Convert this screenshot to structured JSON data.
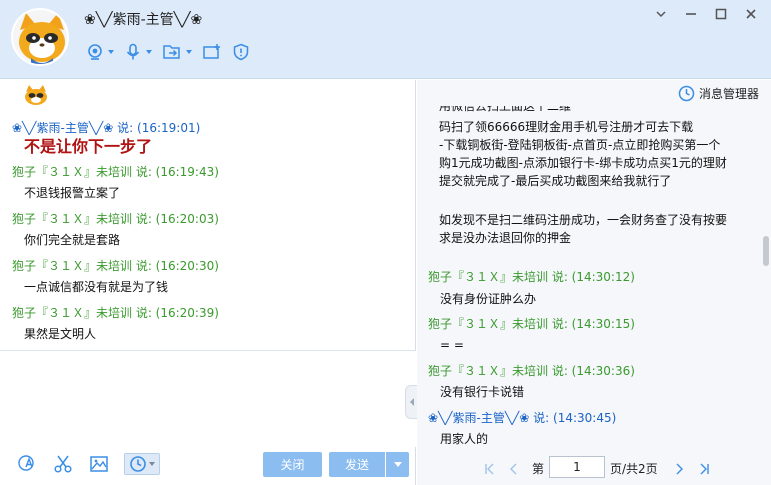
{
  "window": {
    "title": "❀╲╱紫雨-主管╲╱❀"
  },
  "toolbar": {
    "icons": [
      "webcam-icon",
      "microphone-icon",
      "file-transfer-icon",
      "screen-share-icon",
      "shield-icon"
    ]
  },
  "left_chat": {
    "messages": [
      {
        "sender": "❀╲╱紫雨-主管╲╱❀ 说: (16:19:01)",
        "text": "不是让你下一步了",
        "highlight": true
      },
      {
        "sender": "狍子『３１Ｘ』未培训 说: (16:19:43)",
        "text": "不退钱报警立案了"
      },
      {
        "sender": "狍子『３１Ｘ』未培训 说: (16:20:03)",
        "text": "你们完全就是套路"
      },
      {
        "sender": "狍子『３１Ｘ』未培训 说: (16:20:30)",
        "text": "一点诚信都没有就是为了钱"
      },
      {
        "sender": "狍子『３１Ｘ』未培训 说: (16:20:39)",
        "text": "果然是文明人"
      }
    ]
  },
  "bottom_bar": {
    "close_label": "关闭",
    "send_label": "发送"
  },
  "right_panel": {
    "message_manager_label": "消息管理器",
    "cut_line": "用微信去扫上面这个二维",
    "paragraph1": [
      "码扫了领66666理财金用手机号注册才可去下载",
      "-下载铜板街-登陆铜板街-点首页-点立即抢购买第一个",
      "购1元成功截图-点添加银行卡-绑卡成功点买1元的理财",
      "提交就完成了-最后买成功截图来给我就行了"
    ],
    "paragraph2": [
      "如发现不是扫二维码注册成功，一会财务查了没有按要",
      "求是没办法退回你的押金"
    ],
    "messages": [
      {
        "sender": "狍子『３１Ｘ』未培训 说: (14:30:12)",
        "text": "没有身份证肿么办",
        "from": "other"
      },
      {
        "sender": "狍子『３１Ｘ』未培训 说: (14:30:15)",
        "text": "= =",
        "from": "other"
      },
      {
        "sender": "狍子『３１Ｘ』未培训 说: (14:30:36)",
        "text": "没有银行卡说错",
        "from": "other"
      },
      {
        "sender": "❀╲╱紫雨-主管╲╱❀ 说: (14:30:45)",
        "text": "用家人的",
        "from": "me"
      }
    ],
    "pager": {
      "prefix": "第",
      "page": "1",
      "suffix": "页/共2页"
    }
  },
  "colors": {
    "header_bg": "#dceaf9",
    "me_name": "#1b63c6",
    "other_name": "#3a9a2e",
    "highlight_text": "#b11212",
    "button_bg": "#8cbdf0"
  }
}
